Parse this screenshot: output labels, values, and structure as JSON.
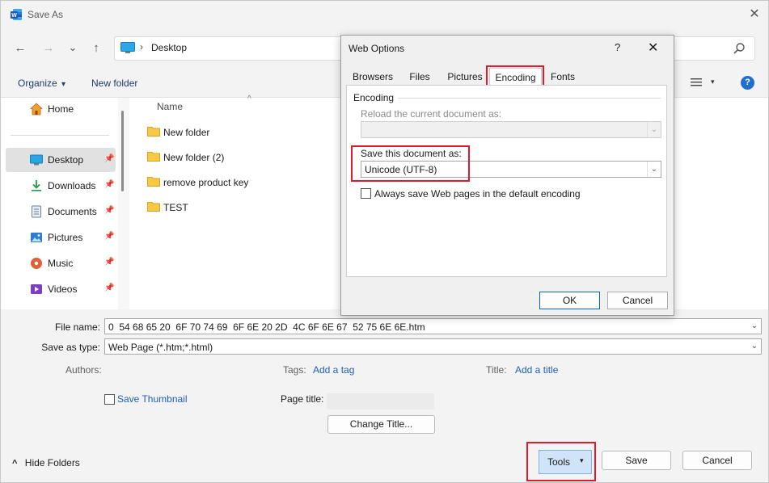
{
  "window": {
    "title": "Save As",
    "close_glyph": "✕"
  },
  "nav": {
    "back_glyph": "←",
    "forward_glyph": "→",
    "recent_glyph": "⌄",
    "up_glyph": "↑",
    "address_sep": "›",
    "address": "Desktop"
  },
  "toolbar": {
    "organize_label": "Organize",
    "organize_arrow": "▾",
    "new_folder_label": "New folder",
    "view_arrow": "▾",
    "help_glyph": "?"
  },
  "sidebar": {
    "items": [
      {
        "label": "Home",
        "icon": "home-icon",
        "pinned": false
      },
      {
        "label": "Desktop",
        "icon": "desktop-icon",
        "pinned": true,
        "selected": true
      },
      {
        "label": "Downloads",
        "icon": "downloads-icon",
        "pinned": true
      },
      {
        "label": "Documents",
        "icon": "documents-icon",
        "pinned": true
      },
      {
        "label": "Pictures",
        "icon": "pictures-icon",
        "pinned": true
      },
      {
        "label": "Music",
        "icon": "music-icon",
        "pinned": true
      },
      {
        "label": "Videos",
        "icon": "videos-icon",
        "pinned": true
      }
    ]
  },
  "filelist": {
    "column_name": "Name",
    "sort_glyph": "^",
    "items": [
      "New folder",
      "New folder (2)",
      "remove product key",
      "TEST"
    ]
  },
  "form": {
    "file_name_label": "File name:",
    "file_name_value": "0  54 68 65 20  6F 70 74 69  6F 6E 20 2D  4C 6F 6E 67  52 75 6E 6E.htm",
    "save_type_label": "Save as type:",
    "save_type_value": "Web Page (*.htm;*.html)",
    "authors_label": "Authors:",
    "tags_label": "Tags:",
    "tags_link": "Add a tag",
    "title_label": "Title:",
    "title_link": "Add a title",
    "save_thumbnail_label": "Save Thumbnail",
    "page_title_label": "Page title:",
    "change_title_label": "Change Title...",
    "dropdown_glyph": "⌄"
  },
  "footer": {
    "hide_folders_label": "Hide Folders",
    "hide_glyph": "^",
    "tools_label": "Tools",
    "tools_arrow": "▾",
    "save_label": "Save",
    "cancel_label": "Cancel"
  },
  "web_options": {
    "title": "Web Options",
    "help_glyph": "?",
    "close_glyph": "✕",
    "tabs": [
      "Browsers",
      "Files",
      "Pictures",
      "Encoding",
      "Fonts"
    ],
    "selected_tab": "Encoding",
    "group_label": "Encoding",
    "reload_label": "Reload the current document as:",
    "reload_value": "",
    "save_doc_label": "Save this document as:",
    "save_doc_value": "Unicode (UTF-8)",
    "always_save_label": "Always save Web pages in the default encoding",
    "ok_label": "OK",
    "cancel_label": "Cancel",
    "dropdown_glyph": "⌄"
  },
  "colors": {
    "accent": "#0067c0",
    "highlight_box": "#e0192f",
    "link": "#1f5fb8"
  }
}
